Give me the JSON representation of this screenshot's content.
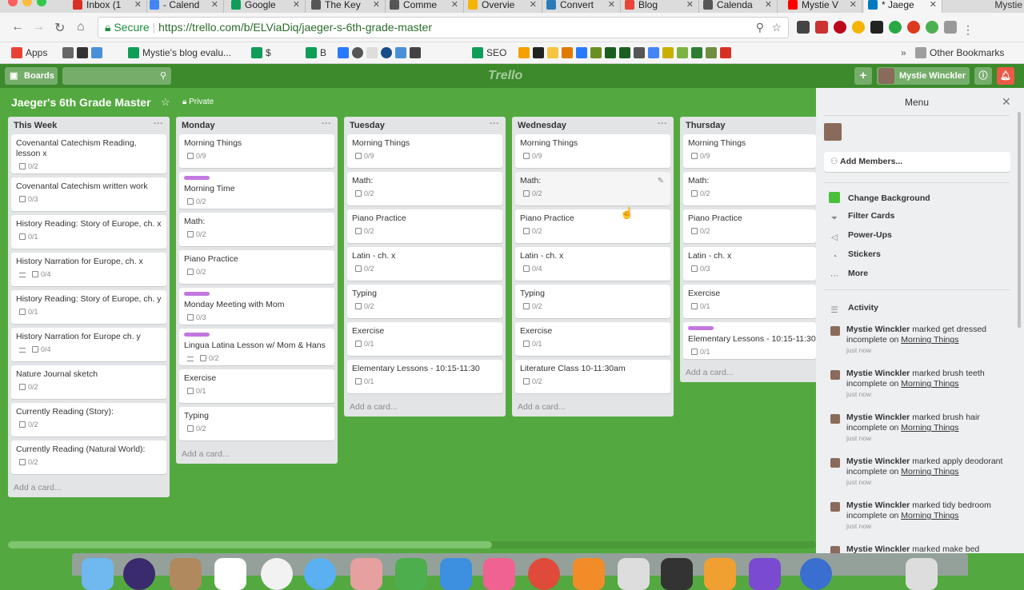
{
  "browser": {
    "tabs": [
      {
        "title": "Inbox (1",
        "color": "#d93025"
      },
      {
        "title": "- Calend",
        "color": "#4285f4"
      },
      {
        "title": "Google",
        "color": "#0f9d58"
      },
      {
        "title": "The Key",
        "color": "#555555"
      },
      {
        "title": "Comme",
        "color": "#555555"
      },
      {
        "title": "Overvie",
        "color": "#f4b400"
      },
      {
        "title": "Convert",
        "color": "#2b7bb9"
      },
      {
        "title": "Blog",
        "color": "#e8443a"
      },
      {
        "title": "Calenda",
        "color": "#555555"
      },
      {
        "title": "Mystie V",
        "color": "#ff0000"
      },
      {
        "title": "* Jaege",
        "color": "#0079bf",
        "active": true
      }
    ],
    "profile_name": "Mystie",
    "secure_label": "Secure",
    "url": "https://trello.com/b/ELViaDiq/jaeger-s-6th-grade-master",
    "bookmarks": [
      "Apps",
      "Mystie's blog evalu...",
      "$",
      "B",
      "SEO",
      "Other Bookmarks"
    ]
  },
  "header": {
    "boards_label": "Boards",
    "logo": "Trello",
    "user_name": "Mystie Winckler"
  },
  "board": {
    "title": "Jaeger's 6th Grade Master",
    "visibility": "Private"
  },
  "lists": [
    {
      "name": "This Week",
      "cards": [
        {
          "title": "Covenantal Catechism Reading, lesson x",
          "checklist": "0/2"
        },
        {
          "title": "Covenantal Catechism written work",
          "checklist": "0/3"
        },
        {
          "title": "History Reading: Story of Europe, ch. x",
          "checklist": "0/1"
        },
        {
          "title": "History Narration for Europe, ch. x",
          "checklist": "0/4",
          "desc": true
        },
        {
          "title": "History Reading: Story of Europe, ch. y",
          "checklist": "0/1"
        },
        {
          "title": "History Narration for Europe ch. y",
          "checklist": "0/4",
          "desc": true
        },
        {
          "title": "Nature Journal sketch",
          "checklist": "0/2"
        },
        {
          "title": "Currently Reading (Story):",
          "checklist": "0/2"
        },
        {
          "title": "Currently Reading (Natural World):",
          "checklist": "0/2"
        }
      ],
      "add": "Add a card..."
    },
    {
      "name": "Monday",
      "cards": [
        {
          "title": "Morning Things",
          "checklist": "0/9"
        },
        {
          "title": "Morning Time",
          "checklist": "0/2",
          "label": true
        },
        {
          "title": "Math:",
          "checklist": "0/2"
        },
        {
          "title": "Piano Practice",
          "checklist": "0/2"
        },
        {
          "title": "Monday Meeting with Mom",
          "checklist": "0/3",
          "label": true
        },
        {
          "title": "Lingua Latina Lesson w/ Mom & Hans",
          "checklist": "0/2",
          "label": true,
          "desc": true
        },
        {
          "title": "Exercise",
          "checklist": "0/1"
        },
        {
          "title": "Typing",
          "checklist": "0/2"
        }
      ],
      "add": "Add a card..."
    },
    {
      "name": "Tuesday",
      "cards": [
        {
          "title": "Morning Things",
          "checklist": "0/9"
        },
        {
          "title": "Math:",
          "checklist": "0/2"
        },
        {
          "title": "Piano Practice",
          "checklist": "0/2"
        },
        {
          "title": "Latin - ch. x",
          "checklist": "0/2"
        },
        {
          "title": "Typing",
          "checklist": "0/2"
        },
        {
          "title": "Exercise",
          "checklist": "0/1"
        },
        {
          "title": "Elementary Lessons - 10:15-11:30",
          "checklist": "0/1"
        }
      ],
      "add": "Add a card..."
    },
    {
      "name": "Wednesday",
      "cards": [
        {
          "title": "Morning Things",
          "checklist": "0/9"
        },
        {
          "title": "Math:",
          "checklist": "0/2",
          "hover": true
        },
        {
          "title": "Piano Practice",
          "checklist": "0/2"
        },
        {
          "title": "Latin - ch. x",
          "checklist": "0/4"
        },
        {
          "title": "Typing",
          "checklist": "0/2"
        },
        {
          "title": "Exercise",
          "checklist": "0/1"
        },
        {
          "title": "Literature Class 10-11:30am",
          "checklist": "0/2"
        }
      ],
      "add": "Add a card..."
    },
    {
      "name": "Thursday",
      "cards": [
        {
          "title": "Morning Things",
          "checklist": "0/9"
        },
        {
          "title": "Math:",
          "checklist": "0/2"
        },
        {
          "title": "Piano Practice",
          "checklist": "0/2"
        },
        {
          "title": "Latin - ch. x",
          "checklist": "0/3"
        },
        {
          "title": "Exercise",
          "checklist": "0/1"
        },
        {
          "title": "Elementary Lessons - 10:15-11:30",
          "checklist": "0/1",
          "label": true
        }
      ],
      "add": "Add a card..."
    }
  ],
  "menu": {
    "title": "Menu",
    "add_members": "Add Members...",
    "items": [
      {
        "label": "Change Background",
        "icon": "green-swatch"
      },
      {
        "label": "Filter Cards",
        "icon": "filter-icon"
      },
      {
        "label": "Power-Ups",
        "icon": "power-up-icon"
      },
      {
        "label": "Stickers",
        "icon": "sticker-icon"
      },
      {
        "label": "More",
        "icon": "more-icon"
      }
    ],
    "activity_title": "Activity",
    "activity": [
      {
        "user": "Mystie Winckler",
        "text": "marked get dressed incomplete on",
        "link": "Morning Things",
        "time": "just now"
      },
      {
        "user": "Mystie Winckler",
        "text": "marked brush teeth incomplete on",
        "link": "Morning Things",
        "time": "just now"
      },
      {
        "user": "Mystie Winckler",
        "text": "marked brush hair incomplete on",
        "link": "Morning Things",
        "time": "just now"
      },
      {
        "user": "Mystie Winckler",
        "text": "marked apply deodorant incomplete on",
        "link": "Morning Things",
        "time": "just now"
      },
      {
        "user": "Mystie Winckler",
        "text": "marked tidy bedroom incomplete on",
        "link": "Morning Things",
        "time": "just now"
      },
      {
        "user": "Mystie Winckler",
        "text": "marked make bed",
        "link": "",
        "time": ""
      }
    ]
  },
  "colors": {
    "board_bg": "#53a93f",
    "header_bg": "#3c8a2b",
    "label_purple": "#c377e0"
  }
}
